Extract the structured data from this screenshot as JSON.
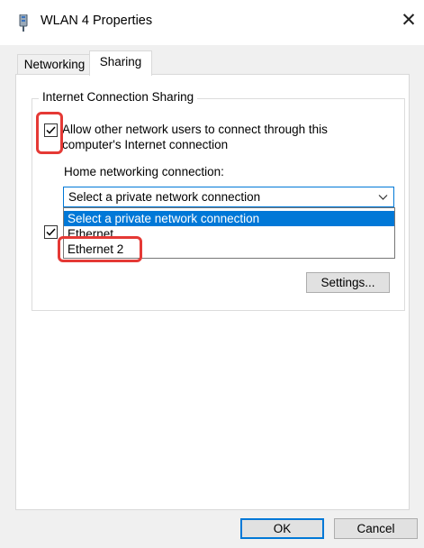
{
  "window": {
    "title": "WLAN 4 Properties",
    "close_glyph": "✕"
  },
  "tabs": [
    {
      "label": "Networking"
    },
    {
      "label": "Sharing"
    }
  ],
  "sharing": {
    "group_title": "Internet Connection Sharing",
    "allow_line1": "Allow other network users to connect through this",
    "allow_line2": "computer's Internet connection",
    "home_label": "Home networking connection:",
    "combo_value": "Select a private network connection",
    "options": [
      "Select a private network connection",
      "Ethernet",
      "Ethernet 2"
    ],
    "settings_button": "Settings..."
  },
  "footer": {
    "ok": "OK",
    "cancel": "Cancel"
  },
  "colors": {
    "accent": "#0078d7",
    "highlight": "#e53935"
  }
}
